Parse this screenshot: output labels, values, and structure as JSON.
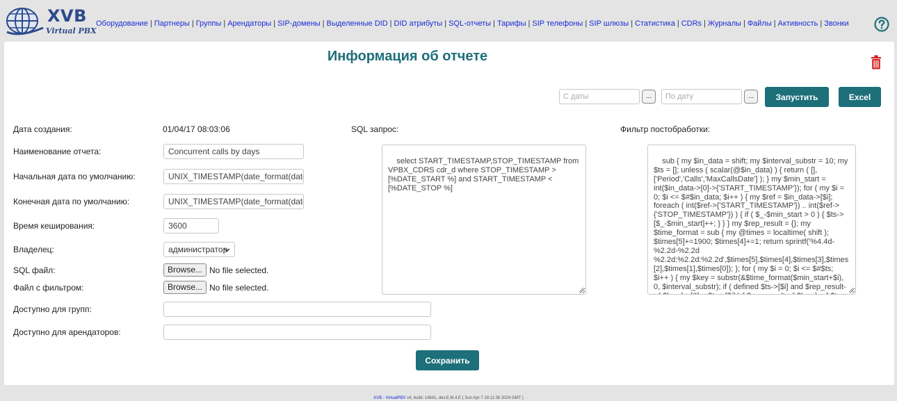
{
  "logo": {
    "title": "XVB",
    "subtitle": "Virtual PBX"
  },
  "nav": [
    "Оборудование",
    "Партнеры",
    "Группы",
    "Арендаторы",
    "SIP-домены",
    "Выделенные DID",
    "DID атрибуты",
    "SQL-отчеты",
    "Тарифы",
    "SIP телефоны",
    "SIP шлюзы",
    "Статистика",
    "CDRs",
    "Журналы",
    "Файлы",
    "Активность",
    "Звонки"
  ],
  "icons": {
    "help": "help-circle-icon",
    "delete": "trash-icon",
    "globe": "globe-logo-icon"
  },
  "colors": {
    "accent": "#1d6f79",
    "link": "#1a2bd6",
    "danger": "#d61f1f",
    "brand": "#2c4b8c"
  },
  "page": {
    "title": "Информация об отчете"
  },
  "toolbar": {
    "from_placeholder": "С даты",
    "to_placeholder": "По дату",
    "dots": "...",
    "run_label": "Запустить",
    "excel_label": "Excel"
  },
  "form": {
    "created_label": "Дата создания:",
    "created_value": "01/04/17 08:03:06",
    "name_label": "Наименование отчета:",
    "name_value": "Concurrent calls by days",
    "start_label": "Начальная дата по умолчанию:",
    "start_value": "UNIX_TIMESTAMP(date_format(date_s",
    "end_label": "Конечная дата по умолчанию:",
    "end_value": "UNIX_TIMESTAMP(date_format(date_s",
    "cache_label": "Время кеширования:",
    "cache_value": "3600",
    "owner_label": "Владелец:",
    "owner_value": "администратор",
    "sql_file_label": "SQL файл:",
    "filter_file_label": "Файл с фильтром:",
    "browse_label": "Browse...",
    "no_file": "No file selected.",
    "groups_label": "Доступно для групп:",
    "groups_value": "",
    "tenants_label": "Доступно для арендаторов:",
    "tenants_value": "",
    "save_label": "Сохранить"
  },
  "sql": {
    "label": "SQL запрос:",
    "value": "select START_TIMESTAMP,STOP_TIMESTAMP from VPBX_CDRS cdr_d where STOP_TIMESTAMP > [%DATE_START %] and START_TIMESTAMP < [%DATE_STOP %]"
  },
  "postfilter": {
    "label": "Фильтр постобработки:",
    "value": "sub { my $in_data = shift; my $interval_substr = 10; my $ts = []; unless ( scalar(@$in_data) ) { return ( [], ['Period','Calls','MaxCallsDate'] ); } my $min_start = int($in_data->[0]->{'START_TIMESTAMP'}); for ( my $i = 0; $i <= $#$in_data; $i++ ) { my $ref = $in_data->[$i]; foreach ( int($ref->{'START_TIMESTAMP'}) .. int($ref->{'STOP_TIMESTAMP'}) ) { if ( $_-$min_start > 0 ) { $ts->[$_-$min_start]++; } } } my $rep_result = {}; my $time_format = sub { my @times = localtime( shift ); $times[5]+=1900; $times[4]+=1; return sprintf('%4.4d-%2.2d-%2.2d %2.2d:%2.2d:%2.2d',$times[5],$times[4],$times[3],$times[2],$times[1],$times[0]); }; for ( my $i = 0; $i <= $#$ts; $i++ ) { my $key = substr(&$time_format($min_start+$i), 0, $interval_substr); if ( defined $ts->[$i] and $rep_result->{ $key }->[0] < $ts->[$i] ) { $rep_result->{ $key } = [ $ts->[$i], $min_start+$i ]; } } my @ret_data = (); foreach my $k ( sort keys %$rep_result ) {"
  },
  "footer": {
    "link": "XVB - VirtualPBX",
    "text": " v4, build: 14841, dev.E.M.4.E ( Sun Apr 7 18:11:36 2024 GMT )"
  }
}
